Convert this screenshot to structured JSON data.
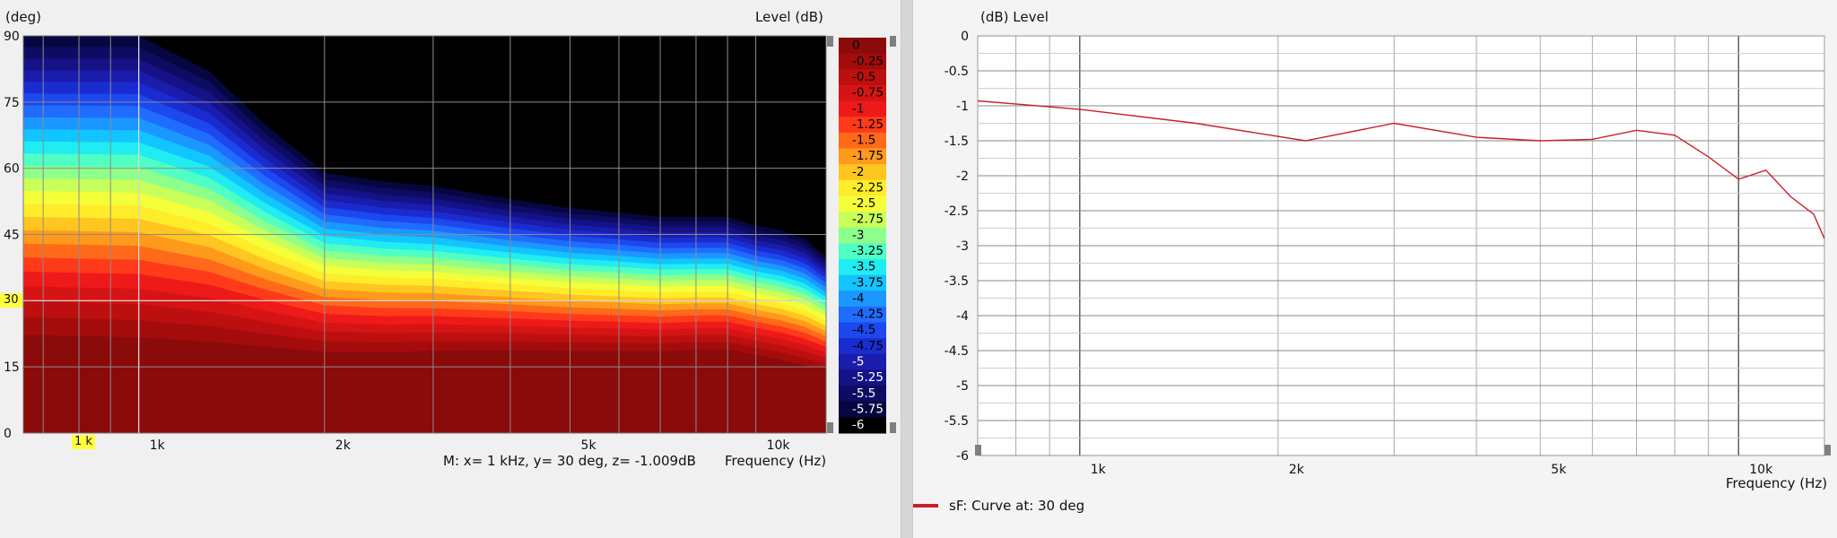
{
  "left_panel": {
    "y_unit": "(deg)",
    "level_header": "Level  (dB)",
    "x_axis_label": "Frequency  (Hz)",
    "marker_readout": "M:  x= 1 kHz,  y= 30 deg, z= -1.009dB",
    "x_marker_tag": "1 k",
    "y_marker_tag": "30"
  },
  "right_panel": {
    "y_unit_header": "(dB)  Level",
    "x_axis_label": "Frequency  (Hz)",
    "legend_label": "sF: Curve at: 30 deg"
  },
  "colors": {
    "curve": "#c8202a",
    "black_region": "#000000",
    "deep_red": "#8b0a0a",
    "marker_yellow": "#ffff3c"
  },
  "chart_data": [
    {
      "type": "heatmap",
      "title": "",
      "xlabel": "Frequency  (Hz)",
      "ylabel": "(deg)",
      "x_scale": "log",
      "xlim": [
        650,
        13000
      ],
      "ylim": [
        0,
        90
      ],
      "x_ticks": [
        {
          "value": 1000,
          "label": "1k"
        },
        {
          "value": 2000,
          "label": "2k"
        },
        {
          "value": 5000,
          "label": "5k"
        },
        {
          "value": 10000,
          "label": "10k"
        }
      ],
      "y_ticks": [
        0,
        15,
        30,
        45,
        60,
        75,
        90
      ],
      "colorbar_label": "Level  (dB)",
      "colorbar_levels": [
        "0",
        "-0.25",
        "-0.5",
        "-0.75",
        "-1",
        "-1.25",
        "-1.5",
        "-1.75",
        "-2",
        "-2.25",
        "-2.5",
        "-2.75",
        "-3",
        "-3.25",
        "-3.5",
        "-3.75",
        "-4",
        "-4.25",
        "-4.5",
        "-4.75",
        "-5",
        "-5.25",
        "-5.5",
        "-5.75",
        "-6"
      ],
      "colorbar_colors": [
        "#8b0a0a",
        "#a40c0c",
        "#bd0f0f",
        "#d61414",
        "#ee1a1a",
        "#ff3a1a",
        "#ff6a1a",
        "#ff9a1a",
        "#ffc520",
        "#ffec2a",
        "#f4ff3a",
        "#c8ff5a",
        "#8eff8a",
        "#50ffc4",
        "#20ecf2",
        "#12c4ff",
        "#1b98ff",
        "#206cff",
        "#1c48ee",
        "#1a2cd0",
        "#1a1cac",
        "#141286",
        "#0d0c62",
        "#060640",
        "#000000"
      ],
      "contour_x": [
        650,
        800,
        1000,
        1300,
        1600,
        2000,
        2500,
        3000,
        4000,
        5000,
        6000,
        7000,
        8000,
        9000,
        10000,
        11000,
        12000,
        13000
      ],
      "contour_top_deg": [
        90,
        90,
        90,
        82,
        70,
        59,
        57,
        56,
        53,
        51,
        50,
        49,
        49,
        49,
        47,
        46,
        44,
        40
      ],
      "contour_bottom_deg": [
        46,
        45,
        44,
        43,
        42,
        41,
        41,
        42,
        43,
        43,
        43,
        43,
        44,
        44,
        41,
        38,
        35,
        32
      ],
      "marker": {
        "x": 1000,
        "y": 30,
        "z": -1.009
      }
    },
    {
      "type": "line",
      "title": "",
      "xlabel": "Frequency  (Hz)",
      "ylabel": "(dB)  Level",
      "x_scale": "log",
      "xlim": [
        700,
        13500
      ],
      "ylim": [
        -6,
        0
      ],
      "x_ticks": [
        {
          "value": 1000,
          "label": "1k"
        },
        {
          "value": 2000,
          "label": "2k"
        },
        {
          "value": 5000,
          "label": "5k"
        },
        {
          "value": 10000,
          "label": "10k"
        }
      ],
      "y_ticks": [
        0,
        -0.5,
        -1,
        -1.5,
        -2,
        -2.5,
        -3,
        -3.5,
        -4,
        -4.5,
        -5,
        -5.5,
        -6
      ],
      "series": [
        {
          "name": "sF: Curve at: 30 deg",
          "x": [
            700,
            1000,
            1500,
            2200,
            3000,
            4000,
            5000,
            6000,
            7000,
            8000,
            9000,
            10000,
            11000,
            12000,
            13000,
            13500
          ],
          "y": [
            -0.93,
            -1.05,
            -1.25,
            -1.5,
            -1.25,
            -1.45,
            -1.5,
            -1.48,
            -1.35,
            -1.42,
            -1.73,
            -2.05,
            -1.92,
            -2.3,
            -2.55,
            -2.9
          ]
        }
      ]
    }
  ]
}
